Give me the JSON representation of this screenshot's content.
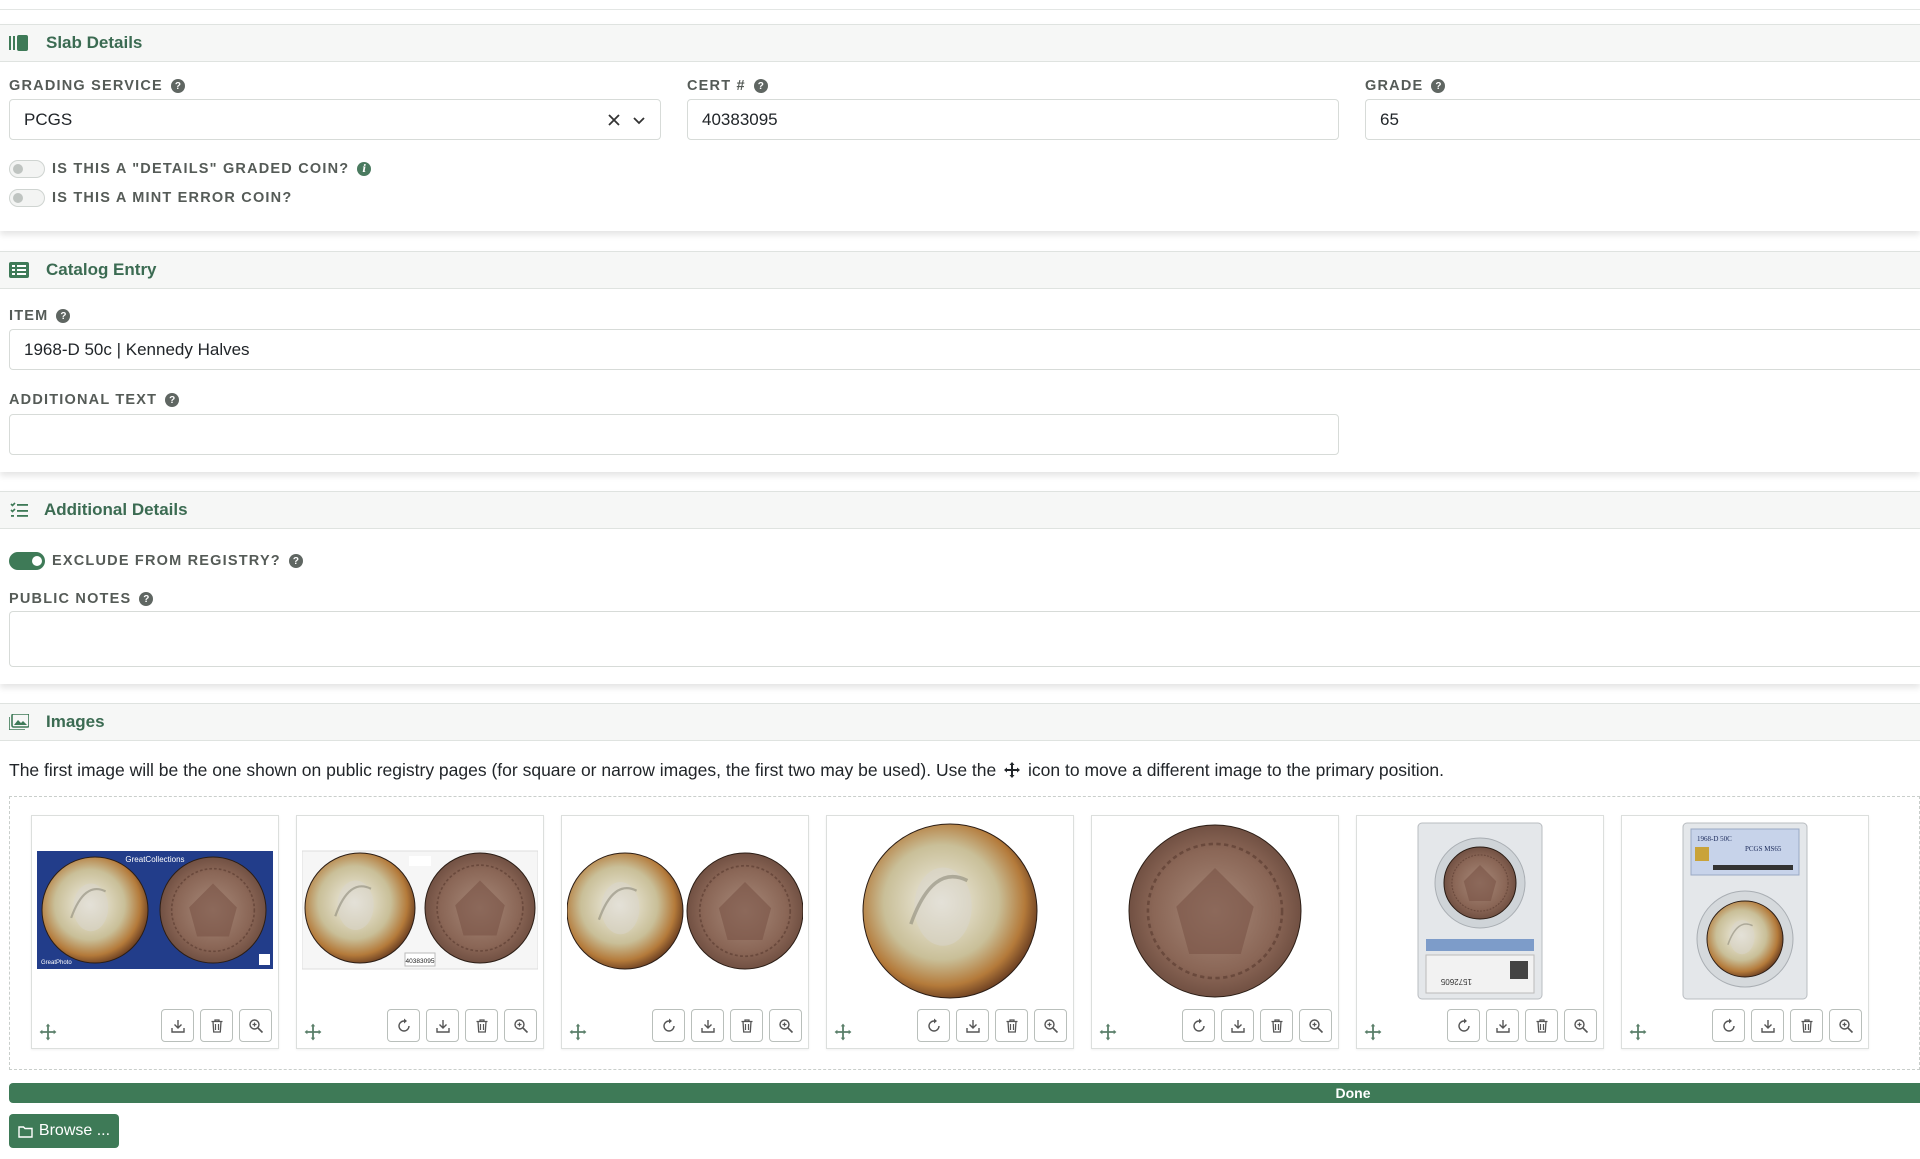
{
  "slab": {
    "title": "Slab Details",
    "grading_label": "GRADING SERVICE",
    "grading_value": "PCGS",
    "cert_label": "CERT #",
    "cert_value": "40383095",
    "grade_label": "GRADE",
    "grade_value": "65",
    "details_toggle_label": "IS THIS A \"DETAILS\" GRADED COIN?",
    "details_toggle_on": false,
    "mint_error_label": "IS THIS A MINT ERROR COIN?",
    "mint_error_on": false
  },
  "catalog": {
    "title": "Catalog Entry",
    "item_label": "ITEM",
    "item_value": "1968-D 50c | Kennedy Halves",
    "additional_text_label": "ADDITIONAL TEXT",
    "additional_text_value": ""
  },
  "additional": {
    "title": "Additional Details",
    "exclude_label": "EXCLUDE FROM REGISTRY?",
    "exclude_on": true,
    "public_notes_label": "PUBLIC NOTES",
    "public_notes_value": ""
  },
  "images": {
    "title": "Images",
    "description_before": "The first image will be the one shown on public registry pages (for square or narrow images, the first two may be used). Use the",
    "description_after": "icon to move a different image to the primary position.",
    "thumbs": [
      {
        "kind": "pair-banner",
        "tools": [
          "download",
          "delete",
          "zoom"
        ],
        "banner_text": "GreatCollections",
        "sub_text": "GreatPhoto"
      },
      {
        "kind": "pair-label",
        "tools": [
          "rotate",
          "download",
          "delete",
          "zoom"
        ],
        "cert_text": "40383095"
      },
      {
        "kind": "pair",
        "tools": [
          "rotate",
          "download",
          "delete",
          "zoom"
        ]
      },
      {
        "kind": "obverse",
        "tools": [
          "rotate",
          "download",
          "delete",
          "zoom"
        ]
      },
      {
        "kind": "reverse",
        "tools": [
          "rotate",
          "download",
          "delete",
          "zoom"
        ]
      },
      {
        "kind": "slab-back",
        "tools": [
          "rotate",
          "download",
          "delete",
          "zoom"
        ],
        "slab_text": "1572605"
      },
      {
        "kind": "slab-front",
        "tools": [
          "rotate",
          "download",
          "delete",
          "zoom"
        ],
        "slab_title": "1968-D 50C",
        "slab_grade": "PCGS MS65"
      }
    ]
  },
  "upload": {
    "progress_label": "Done",
    "progress_percent": 100,
    "browse_label": "Browse ..."
  },
  "colors": {
    "accent": "#3e7a57",
    "section_title": "#3b6b52",
    "label": "#555b57"
  }
}
